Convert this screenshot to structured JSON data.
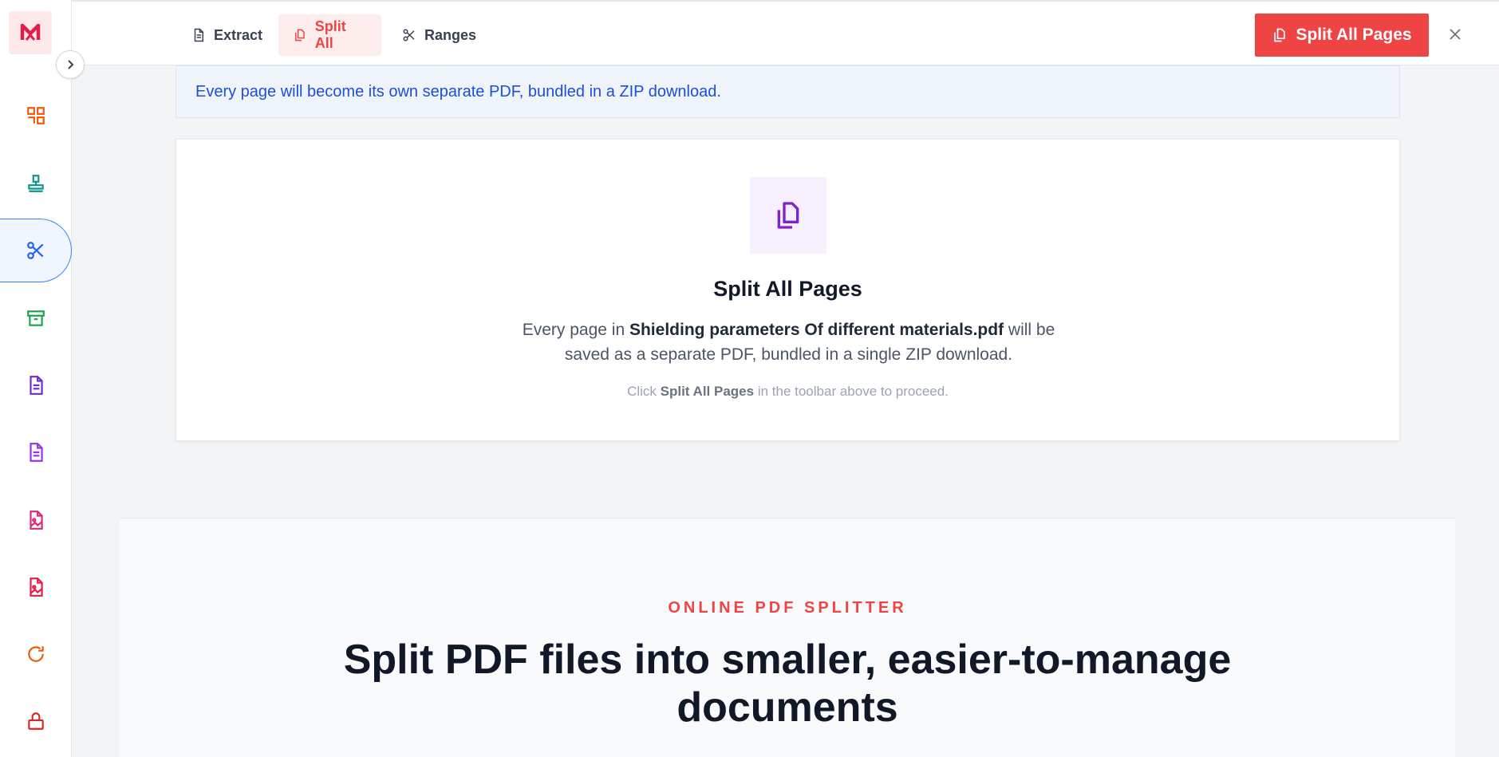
{
  "header": {
    "tabs": [
      {
        "label": "Extract",
        "icon": "document-icon"
      },
      {
        "label": "Split All",
        "icon": "copy-icon"
      },
      {
        "label": "Ranges",
        "icon": "scissors-icon"
      }
    ],
    "primary_button": "Split All Pages"
  },
  "sidebar": {
    "items": [
      {
        "icon": "organize-icon",
        "color": "#ea580c"
      },
      {
        "icon": "stamp-icon",
        "color": "#0d9488"
      },
      {
        "icon": "scissors-icon",
        "color": "#2563eb"
      },
      {
        "icon": "archive-icon",
        "color": "#16a34a"
      },
      {
        "icon": "document-icon",
        "color": "#6d28d9"
      },
      {
        "icon": "document-icon",
        "color": "#9333ea"
      },
      {
        "icon": "image-file-icon",
        "color": "#db2777"
      },
      {
        "icon": "image-file-icon",
        "color": "#e11d48"
      },
      {
        "icon": "rotate-icon",
        "color": "#ea580c"
      },
      {
        "icon": "lock-icon",
        "color": "#dc2626"
      }
    ]
  },
  "banner": {
    "text": "Every page will become its own separate PDF, bundled in a ZIP download."
  },
  "card": {
    "title": "Split All Pages",
    "desc_prefix": "Every page in ",
    "filename": "Shielding parameters Of different materials.pdf",
    "desc_suffix": " will be saved as a separate PDF, bundled in a single ZIP download.",
    "hint_prefix": "Click ",
    "hint_bold": "Split All Pages",
    "hint_suffix": " in the toolbar above to proceed."
  },
  "hero": {
    "eyebrow": "ONLINE PDF SPLITTER",
    "title": "Split PDF files into smaller, easier-to-manage documents"
  },
  "colors": {
    "accent": "#ef4444",
    "info": "#1d4ed8",
    "purple": "#7e22ce"
  }
}
